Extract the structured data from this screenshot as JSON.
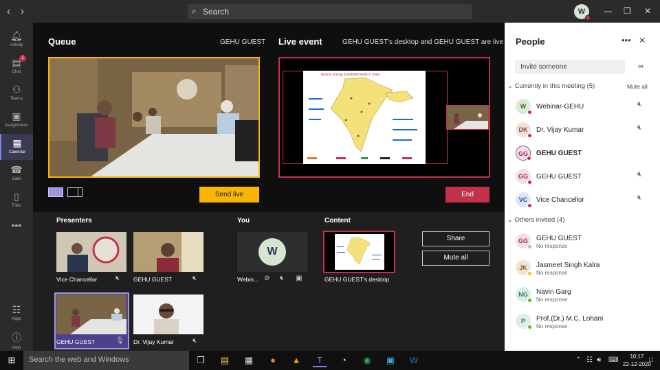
{
  "titlebar": {
    "search_placeholder": "Search",
    "avatar_initial": "W"
  },
  "rail": [
    {
      "label": "Activity",
      "icon": "bell-icon"
    },
    {
      "label": "Chat",
      "icon": "chat-icon",
      "badge": "1"
    },
    {
      "label": "Teams",
      "icon": "teams-icon"
    },
    {
      "label": "Assignments",
      "icon": "assignments-icon"
    },
    {
      "label": "Calendar",
      "icon": "calendar-icon"
    },
    {
      "label": "Calls",
      "icon": "phone-icon"
    },
    {
      "label": "Files",
      "icon": "file-icon"
    },
    {
      "label": "Apps",
      "icon": "apps-icon"
    },
    {
      "label": "Help",
      "icon": "help-icon"
    }
  ],
  "queue": {
    "title": "Queue",
    "presenter": "GEHU GUEST",
    "send_live": "Send live"
  },
  "live": {
    "title": "Live event",
    "status": "GEHU GUEST's desktop and GEHU GUEST are live",
    "end": "End",
    "slide_title": "Atomic Energy Establishments in India"
  },
  "presenters": {
    "title": "Presenters",
    "tiles": [
      {
        "name": "Vice Chancellor"
      },
      {
        "name": "GEHU GUEST"
      },
      {
        "name": "GEHU GUEST"
      },
      {
        "name": "Dr. Vijay Kumar"
      }
    ]
  },
  "you": {
    "title": "You",
    "initial": "W",
    "name": "Webin..."
  },
  "content": {
    "title": "Content",
    "name": "GEHU GUEST's desktop",
    "share": "Share",
    "mute_all": "Mute all"
  },
  "people": {
    "title": "People",
    "invite_placeholder": "Invite someone",
    "current_group": "Currently in this meeting (5)",
    "mute_all": "Mute all",
    "current": [
      {
        "initials": "W",
        "name": "Webinar-GEHU",
        "bg": "#dce9d5",
        "fg": "#3a6b2f",
        "status": "#c4314b"
      },
      {
        "initials": "DK",
        "name": "Dr. Vijay Kumar",
        "bg": "#f3e0d8",
        "fg": "#8a4a33",
        "status": "#c4314b"
      },
      {
        "initials": "GG",
        "name": "GEHU GUEST",
        "bg": "#f6dde8",
        "fg": "#9b2c5c",
        "status": "#c4314b"
      },
      {
        "initials": "GG",
        "name": "GEHU GUEST",
        "bg": "#f6dde8",
        "fg": "#9b2c5c",
        "status": "#c4314b"
      },
      {
        "initials": "VC",
        "name": "Vice Chancellor",
        "bg": "#dde6f7",
        "fg": "#2f4f8a",
        "status": "#c4314b"
      }
    ],
    "others_group": "Others invited (4)",
    "others": [
      {
        "initials": "GG",
        "name": "GEHU GUEST",
        "sub": "No response",
        "bg": "#f6dde8",
        "fg": "#9b2c5c",
        "status": "#bbbbbb"
      },
      {
        "initials": "JK",
        "name": "Jasmeet Singh Kalra",
        "sub": "No response",
        "bg": "#f3e3d2",
        "fg": "#8a5a2f",
        "status": "#f8c21a"
      },
      {
        "initials": "NG",
        "name": "Navin Garg",
        "sub": "No response",
        "bg": "#d9efe6",
        "fg": "#2d7a5a",
        "status": "#6bb700"
      },
      {
        "initials": "P",
        "name": "Prof.(Dr.) M.C. Lohani",
        "sub": "No response",
        "bg": "#dcefe3",
        "fg": "#2d7a4a",
        "status": "#6bb700"
      }
    ]
  },
  "taskbar": {
    "search_placeholder": "Search the web and Windows",
    "time": "10:17",
    "date": "22-12-2020"
  }
}
